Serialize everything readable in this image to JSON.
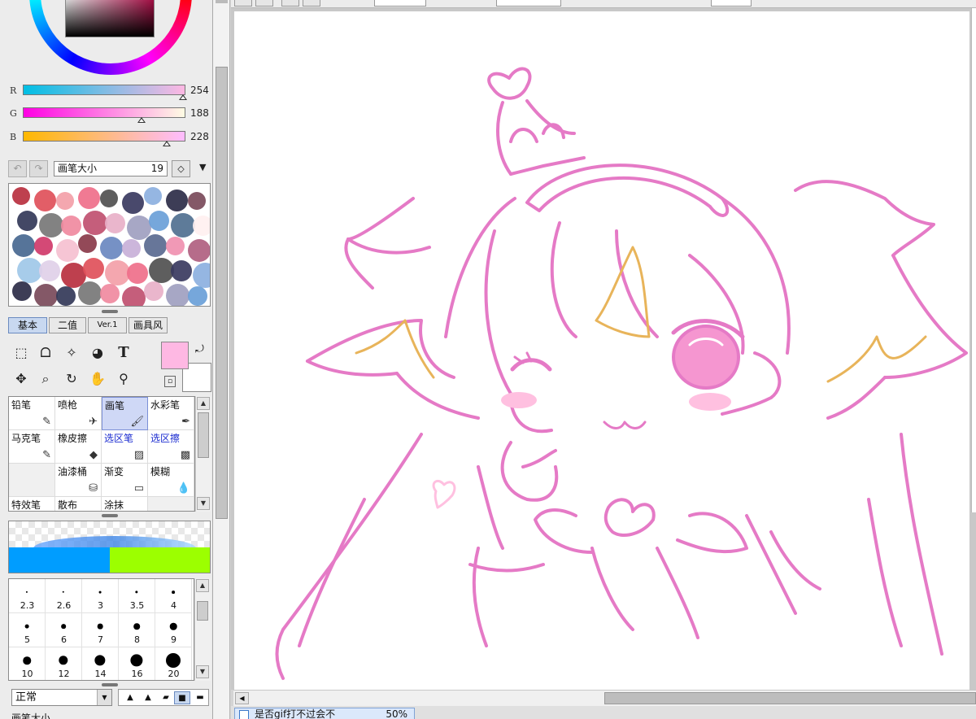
{
  "colors": {
    "main": "#feb8e3",
    "sub": "#ffffff",
    "line_art": "#e57ac6",
    "hair_accent": "#e8b45a",
    "blush": "#ffc0e0"
  },
  "color_sliders": [
    {
      "label": "R",
      "value": "254",
      "fraction": 0.996
    },
    {
      "label": "G",
      "value": "188",
      "fraction": 0.737
    },
    {
      "label": "B",
      "value": "228",
      "fraction": 0.894
    }
  ],
  "brush_size": {
    "label": "画笔大小",
    "value": "19"
  },
  "tabs": [
    {
      "label": "基本",
      "active": true
    },
    {
      "label": "二值",
      "active": false
    },
    {
      "label": "Ver.1",
      "active": false
    },
    {
      "label": "画具风",
      "active": false
    }
  ],
  "tools": {
    "text_tool_glyph": "T"
  },
  "brushes": [
    {
      "label": "铅笔",
      "icon": "pencil-icon",
      "selected": false,
      "blue": false
    },
    {
      "label": "喷枪",
      "icon": "airbrush-icon",
      "selected": false,
      "blue": false
    },
    {
      "label": "画笔",
      "icon": "brush-icon",
      "selected": true,
      "blue": false
    },
    {
      "label": "水彩笔",
      "icon": "watercolor-icon",
      "selected": false,
      "blue": false
    },
    {
      "label": "马克笔",
      "icon": "marker-icon",
      "selected": false,
      "blue": false
    },
    {
      "label": "橡皮擦",
      "icon": "eraser-icon",
      "selected": false,
      "blue": false
    },
    {
      "label": "选区笔",
      "icon": "selection-pen-icon",
      "selected": false,
      "blue": true
    },
    {
      "label": "选区擦",
      "icon": "selection-eraser-icon",
      "selected": false,
      "blue": true
    },
    {
      "label": "",
      "icon": "",
      "selected": false,
      "blue": false
    },
    {
      "label": "油漆桶",
      "icon": "bucket-icon",
      "selected": false,
      "blue": false
    },
    {
      "label": "渐变",
      "icon": "gradient-icon",
      "selected": false,
      "blue": false
    },
    {
      "label": "模糊",
      "icon": "blur-icon",
      "selected": false,
      "blue": false
    },
    {
      "label": "特效笔",
      "icon": "",
      "selected": false,
      "blue": false
    },
    {
      "label": "散布",
      "icon": "",
      "selected": false,
      "blue": false
    },
    {
      "label": "涂抹",
      "icon": "",
      "selected": false,
      "blue": false
    },
    {
      "label": "",
      "icon": "",
      "selected": false,
      "blue": false
    }
  ],
  "sizes": [
    "2.3",
    "2.6",
    "3",
    "3.5",
    "4",
    "5",
    "6",
    "7",
    "8",
    "9",
    "10",
    "12",
    "14",
    "16",
    "20"
  ],
  "blend_mode": "正常",
  "density_label": "画笔大小",
  "document": {
    "title": "是否gif打不过会不",
    "zoom": "50%"
  }
}
